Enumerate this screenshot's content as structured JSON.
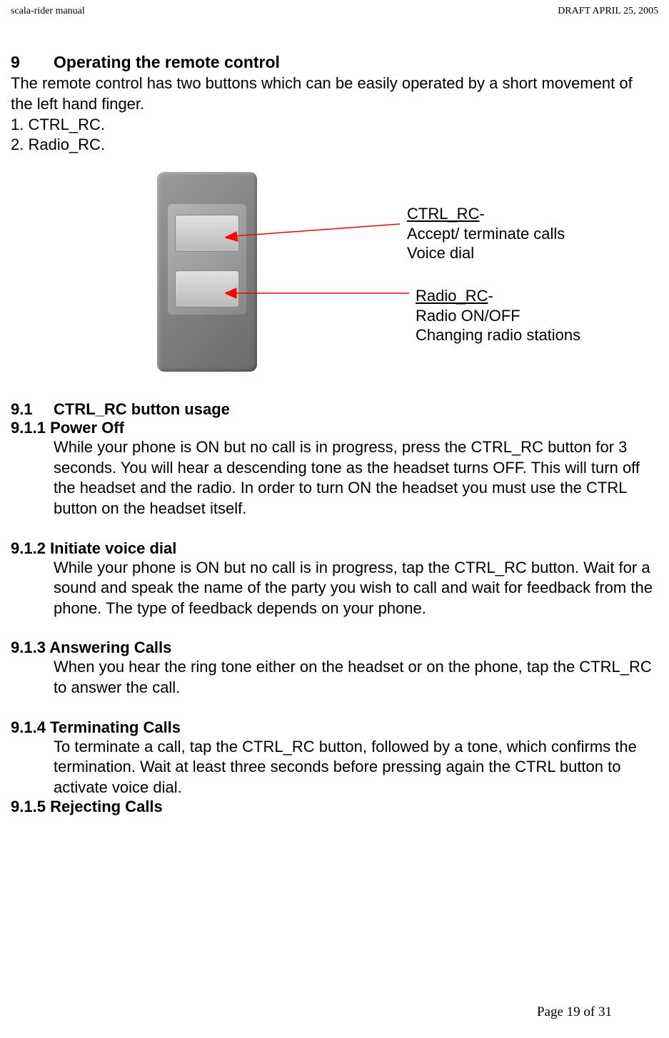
{
  "header": {
    "left": "scala-rider manual",
    "right": "DRAFT  APRIL 25, 2005"
  },
  "section": {
    "number": "9",
    "title": "Operating the remote control",
    "intro": "The remote control has two buttons which can be easily operated by a short movement of the left hand finger.",
    "list": [
      "1. CTRL_RC.",
      "2. Radio_RC."
    ]
  },
  "callouts": {
    "c1": {
      "title": "CTRL_RC",
      "line2": "Accept/ terminate calls",
      "line3": "Voice dial"
    },
    "c2": {
      "title": "Radio_RC",
      "line2": "Radio ON/OFF",
      "line3": "Changing radio stations"
    }
  },
  "sub": {
    "number": "9.1",
    "title": "CTRL_RC button usage"
  },
  "items": {
    "i1": {
      "num": "9.1.1",
      "title": "Power Off",
      "body": "While your phone is ON but no call is in progress, press the CTRL_RC button for 3 seconds. You will hear a descending tone as the headset turns OFF. This will turn off the headset and the radio. In order to turn ON the headset you must use the CTRL button on the headset itself."
    },
    "i2": {
      "num": "9.1.2",
      "title": "Initiate voice dial",
      "body": "While your phone is ON but no call is in progress, tap the CTRL_RC button. Wait for a sound and speak the name of the party you wish to call and wait for feedback from the phone. The type of feedback depends on your phone."
    },
    "i3": {
      "num": "9.1.3",
      "title": "Answering Calls",
      "body": "When you hear the ring tone either on the headset or on the phone, tap the CTRL_RC to answer the call."
    },
    "i4": {
      "num": "9.1.4",
      "title": "Terminating Calls",
      "body": "To terminate a call, tap the CTRL_RC button, followed by a tone, which confirms the termination. Wait at least three seconds before pressing again the CTRL button to activate voice dial."
    },
    "i5": {
      "num": "9.1.5",
      "title": "Rejecting Calls"
    }
  },
  "footer": "Page 19 of 31"
}
